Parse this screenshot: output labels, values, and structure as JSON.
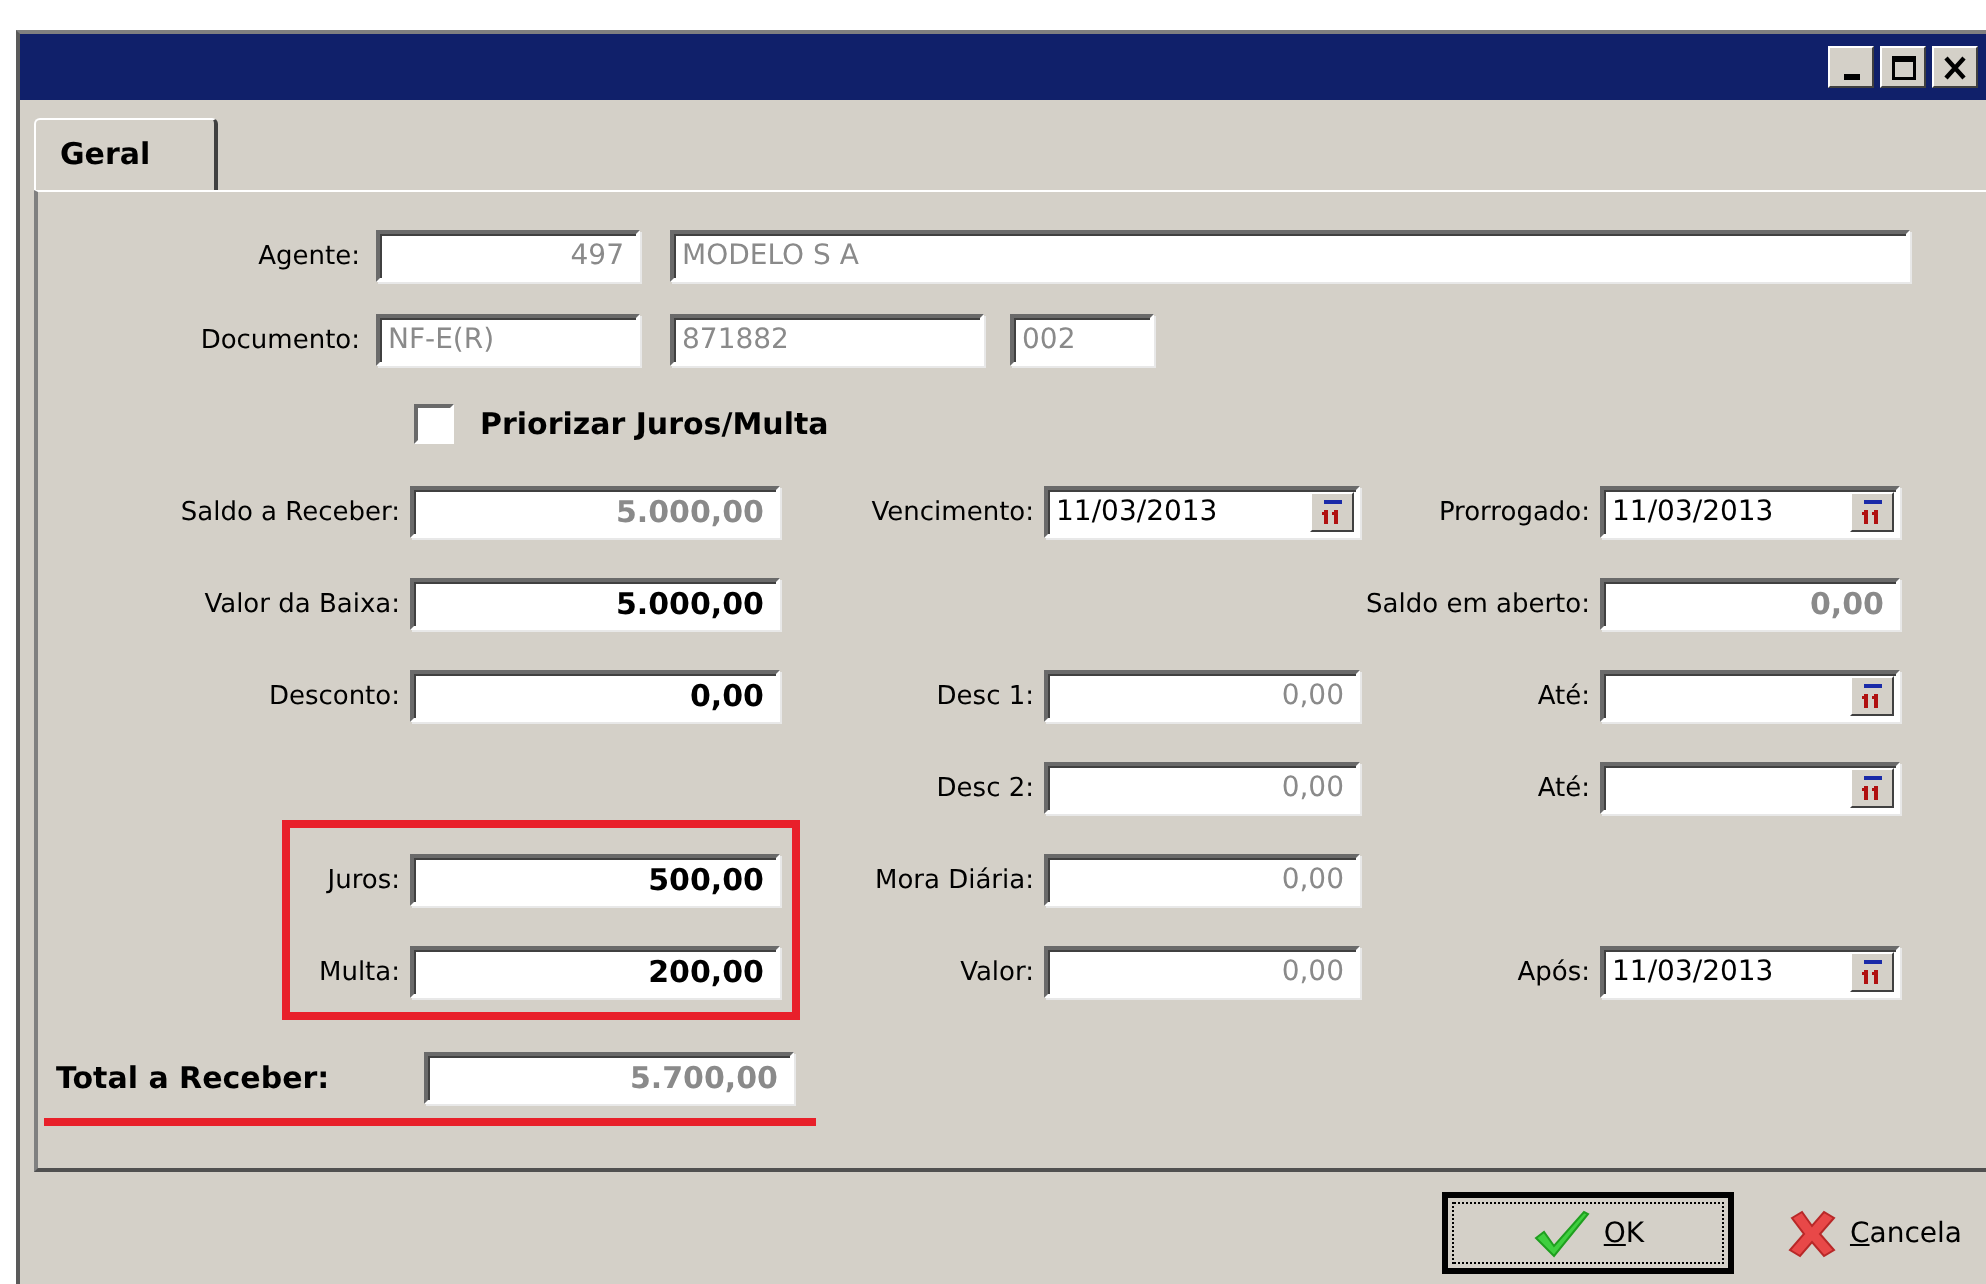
{
  "window": {
    "controls": [
      {
        "kind": "minimize"
      },
      {
        "kind": "maximize"
      },
      {
        "kind": "close"
      }
    ]
  },
  "tabs": [
    {
      "label": "Geral",
      "selected": true
    }
  ],
  "agente": {
    "label": "Agente:",
    "code": "497",
    "name": "MODELO S A",
    "disabled": true
  },
  "documento": {
    "label": "Documento:",
    "values": [
      "NF-E(R)",
      "871882",
      "002"
    ],
    "disabled": true
  },
  "priorizar": {
    "label": "Priorizar Juros/Multa",
    "checked": false
  },
  "rows": [
    {
      "highlighted": false,
      "left": {
        "label": "Saldo a Receber:",
        "value": "5.000,00",
        "kind": "amount",
        "disabled": true
      },
      "middle": {
        "label": "Vencimento:",
        "value": "11/03/2013",
        "kind": "date",
        "disabled": false
      },
      "right": {
        "label": "Prorrogado:",
        "value": "11/03/2013",
        "kind": "date",
        "disabled": false
      }
    },
    {
      "highlighted": false,
      "left": {
        "label": "Valor da Baixa:",
        "value": "5.000,00",
        "kind": "amount",
        "disabled": false
      },
      "right": {
        "label": "Saldo em aberto:",
        "value": "0,00",
        "kind": "amount",
        "disabled": true
      }
    },
    {
      "highlighted": false,
      "left": {
        "label": "Desconto:",
        "value": "0,00",
        "kind": "amount",
        "disabled": false
      },
      "middle": {
        "label": "Desc 1:",
        "value": "0,00",
        "kind": "number",
        "disabled": true
      },
      "right": {
        "label": "Até:",
        "kind": "date"
      }
    },
    {
      "highlighted": false,
      "middle": {
        "label": "Desc 2:",
        "value": "0,00",
        "kind": "number",
        "disabled": true
      },
      "right": {
        "label": "Até:",
        "kind": "date"
      }
    },
    {
      "highlighted": true,
      "left": {
        "label": "Juros:",
        "value": "500,00",
        "kind": "amount",
        "disabled": false
      },
      "middle": {
        "label": "Mora Diária:",
        "value": "0,00",
        "kind": "number",
        "disabled": true
      }
    },
    {
      "highlighted": true,
      "left": {
        "label": "Multa:",
        "value": "200,00",
        "kind": "amount",
        "disabled": false
      },
      "middle": {
        "label": "Valor:",
        "value": "0,00",
        "kind": "number",
        "disabled": true
      },
      "right": {
        "label": "Após:",
        "value": "11/03/2013",
        "kind": "date",
        "disabled": false
      }
    }
  ],
  "total": {
    "label": "Total a Receber:",
    "value": "5.700,00",
    "disabled": true,
    "underlined": true
  },
  "buttons": [
    {
      "label": "OK",
      "kind": "ok",
      "default": true
    },
    {
      "label": "Cancela",
      "kind": "cancel",
      "default": false
    }
  ]
}
